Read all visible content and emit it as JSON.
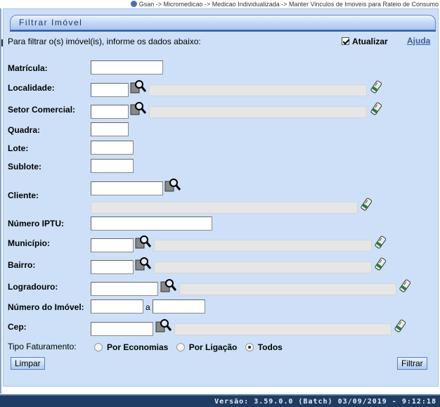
{
  "breadcrumb": "Gsan -> Micromedicao -> Medicao Individualizada -> Manter Vinculos de Imoveis para Rateio de Consumo",
  "panel": {
    "title": "Filtrar Imóvel"
  },
  "instructions": "Para filtrar o(s) imóvel(is), informe os dados abaixo:",
  "update_checkbox": {
    "label": "Atualizar",
    "checked": true
  },
  "help_link": "Ajuda",
  "fields": {
    "matricula": {
      "label": "Matrícula:",
      "value": ""
    },
    "localidade": {
      "label": "Localidade:",
      "value": "",
      "description": ""
    },
    "setor_comercial": {
      "label": "Setor Comercial:",
      "value": "",
      "description": ""
    },
    "quadra": {
      "label": "Quadra:",
      "value": ""
    },
    "lote": {
      "label": "Lote:",
      "value": ""
    },
    "sublote": {
      "label": "Sublote:",
      "value": ""
    },
    "cliente": {
      "label": "Cliente:",
      "value": "",
      "description": ""
    },
    "numero_iptu": {
      "label": "Número IPTU:",
      "value": ""
    },
    "municipio": {
      "label": "Município:",
      "value": "",
      "description": ""
    },
    "bairro": {
      "label": "Bairro:",
      "value": "",
      "description": ""
    },
    "logradouro": {
      "label": "Logradouro:",
      "value": "",
      "description": ""
    },
    "numero_imovel": {
      "label": "Número do Imóvel:",
      "from": "",
      "separator": "a",
      "to": ""
    },
    "cep": {
      "label": "Cep:",
      "value": "",
      "description": ""
    }
  },
  "tipo_faturamento": {
    "label": "Tipo Faturamento:",
    "options": [
      "Por Economias",
      "Por Ligação",
      "Todos"
    ],
    "selected": "Todos"
  },
  "buttons": {
    "clear": "Limpar",
    "filter": "Filtrar"
  },
  "footer": "Versão: 3.59.0.0 (Batch) 03/09/2019 - 9:12:18",
  "colors": {
    "panel_bg": "#cde0f7",
    "title_text": "#123a78",
    "footer_bg": "#1f3d62"
  }
}
